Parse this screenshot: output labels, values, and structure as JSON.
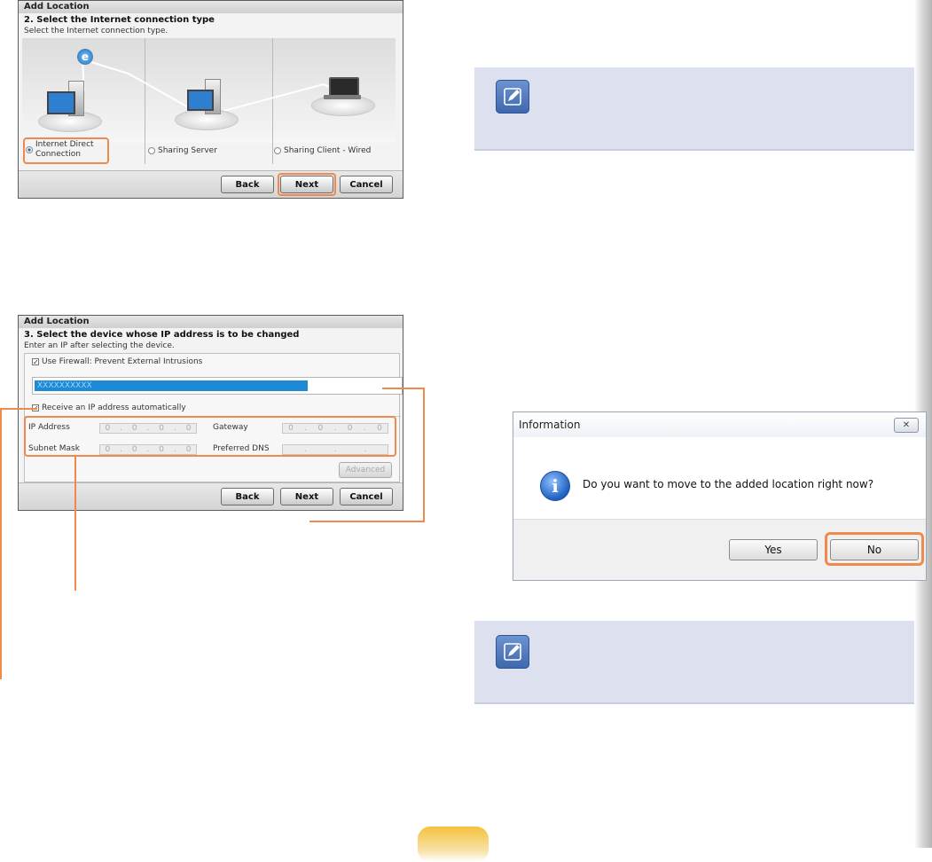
{
  "wizard1": {
    "title": "Add Location",
    "step": "2. Select the Internet connection type",
    "subtitle": "Select the Internet connection type.",
    "options": [
      {
        "label_line1": "Internet Direct",
        "label_line2": "Connection",
        "selected": true
      },
      {
        "label": "Sharing Server",
        "selected": false
      },
      {
        "label": "Sharing Client - Wired",
        "selected": false
      }
    ],
    "buttons": {
      "back": "Back",
      "next": "Next",
      "cancel": "Cancel"
    }
  },
  "wizard2": {
    "title": "Add Location",
    "step": "3. Select the device whose IP address is to be changed",
    "subtitle": "Enter an IP after selecting the device.",
    "firewall_label": "Use Firewall: Prevent External Intrusions",
    "firewall_checked": true,
    "device_selected": "XXXXXXXXXX",
    "auto_ip_label": "Receive an IP address automatically",
    "auto_ip_checked": true,
    "fields": {
      "ip_label": "IP Address",
      "gateway_label": "Gateway",
      "subnet_label": "Subnet Mask",
      "dns_label": "Preferred DNS",
      "ip_value": [
        "0",
        "0",
        "0",
        "0"
      ],
      "gateway_value": [
        "0",
        "0",
        "0",
        "0"
      ],
      "subnet_value": [
        "0",
        "0",
        "0",
        "0"
      ],
      "dns_value": [
        "",
        "",
        "",
        ""
      ]
    },
    "advanced_label": "Advanced",
    "buttons": {
      "back": "Back",
      "next": "Next",
      "cancel": "Cancel"
    }
  },
  "dialog": {
    "title": "Information",
    "close_glyph": "✕",
    "message": "Do you want to move to the added location right now?",
    "yes": "Yes",
    "no": "No"
  },
  "colors": {
    "highlight": "#ef8a4c",
    "note_bg": "#dde0ee",
    "note_icon": "#4a72b8",
    "progress": "#1d8ad6"
  }
}
